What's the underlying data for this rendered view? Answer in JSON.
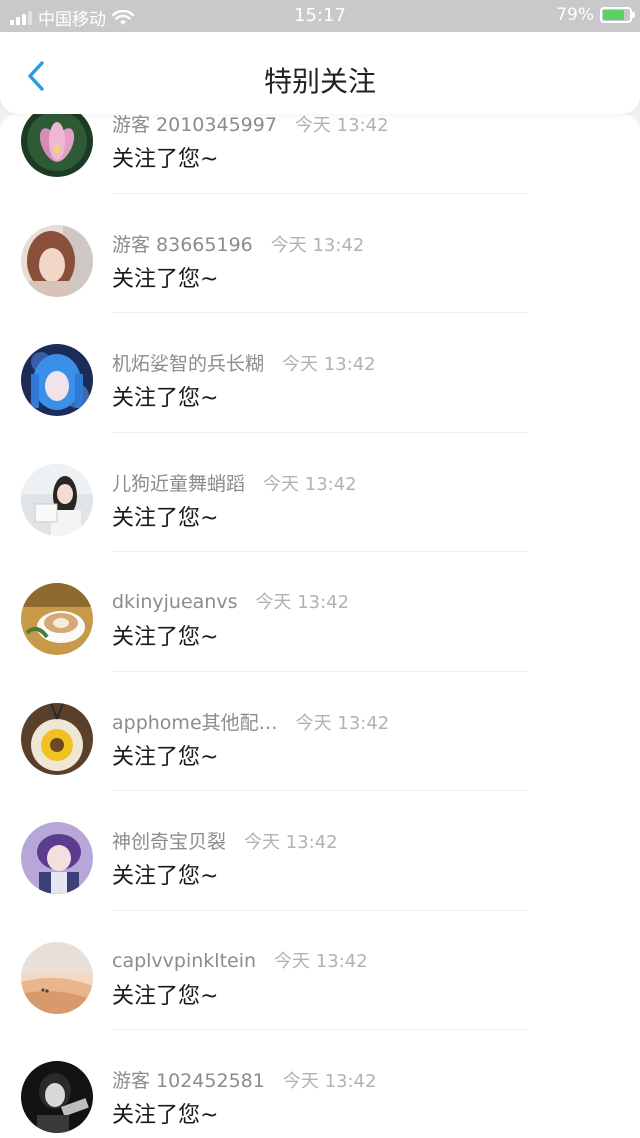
{
  "status_bar": {
    "carrier": "中国移动",
    "time": "15:17",
    "battery_percent": "79%",
    "battery_level": 0.79,
    "wifi_icon": "wifi-icon",
    "signal_icon": "signal-icon"
  },
  "nav": {
    "title": "特别关注",
    "back_icon": "chevron-left-icon"
  },
  "colors": {
    "accent": "#2a9ae6",
    "status_bar_bg": "#c9c9cc",
    "battery_fill": "#56d364"
  },
  "items": [
    {
      "username": "游客 2010345997",
      "time": "今天 13:42",
      "message": "关注了您~",
      "avatar": "lotus-flower"
    },
    {
      "username": "游客 83665196",
      "time": "今天 13:42",
      "message": "关注了您~",
      "avatar": "girl-portrait"
    },
    {
      "username": "机炻娑智的兵长糊",
      "time": "今天 13:42",
      "message": "关注了您~",
      "avatar": "anime-blue-hair"
    },
    {
      "username": "儿狗近童舞蛸蹈",
      "time": "今天 13:42",
      "message": "关注了您~",
      "avatar": "woman-reading"
    },
    {
      "username": "dkinyjueanvs",
      "time": "今天 13:42",
      "message": "关注了您~",
      "avatar": "latte-cup"
    },
    {
      "username": "apphome其他配…",
      "time": "今天 13:42",
      "message": "关注了您~",
      "avatar": "sunflower-pendant"
    },
    {
      "username": "神创奇宝贝裂",
      "time": "今天 13:42",
      "message": "关注了您~",
      "avatar": "anime-boy"
    },
    {
      "username": "caplvvpinkltein",
      "time": "今天 13:42",
      "message": "关注了您~",
      "avatar": "beach-scene"
    },
    {
      "username": "游客 102452581",
      "time": "今天 13:42",
      "message": "关注了您~",
      "avatar": "bw-portrait"
    }
  ]
}
